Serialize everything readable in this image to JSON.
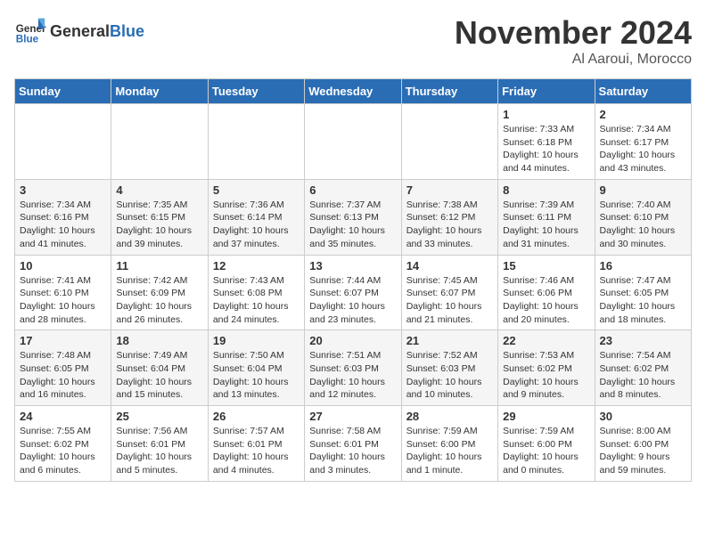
{
  "header": {
    "logo_general": "General",
    "logo_blue": "Blue",
    "month_title": "November 2024",
    "location": "Al Aaroui, Morocco"
  },
  "weekdays": [
    "Sunday",
    "Monday",
    "Tuesday",
    "Wednesday",
    "Thursday",
    "Friday",
    "Saturday"
  ],
  "weeks": [
    [
      {
        "day": "",
        "content": ""
      },
      {
        "day": "",
        "content": ""
      },
      {
        "day": "",
        "content": ""
      },
      {
        "day": "",
        "content": ""
      },
      {
        "day": "",
        "content": ""
      },
      {
        "day": "1",
        "content": "Sunrise: 7:33 AM\nSunset: 6:18 PM\nDaylight: 10 hours and 44 minutes."
      },
      {
        "day": "2",
        "content": "Sunrise: 7:34 AM\nSunset: 6:17 PM\nDaylight: 10 hours and 43 minutes."
      }
    ],
    [
      {
        "day": "3",
        "content": "Sunrise: 7:34 AM\nSunset: 6:16 PM\nDaylight: 10 hours and 41 minutes."
      },
      {
        "day": "4",
        "content": "Sunrise: 7:35 AM\nSunset: 6:15 PM\nDaylight: 10 hours and 39 minutes."
      },
      {
        "day": "5",
        "content": "Sunrise: 7:36 AM\nSunset: 6:14 PM\nDaylight: 10 hours and 37 minutes."
      },
      {
        "day": "6",
        "content": "Sunrise: 7:37 AM\nSunset: 6:13 PM\nDaylight: 10 hours and 35 minutes."
      },
      {
        "day": "7",
        "content": "Sunrise: 7:38 AM\nSunset: 6:12 PM\nDaylight: 10 hours and 33 minutes."
      },
      {
        "day": "8",
        "content": "Sunrise: 7:39 AM\nSunset: 6:11 PM\nDaylight: 10 hours and 31 minutes."
      },
      {
        "day": "9",
        "content": "Sunrise: 7:40 AM\nSunset: 6:10 PM\nDaylight: 10 hours and 30 minutes."
      }
    ],
    [
      {
        "day": "10",
        "content": "Sunrise: 7:41 AM\nSunset: 6:10 PM\nDaylight: 10 hours and 28 minutes."
      },
      {
        "day": "11",
        "content": "Sunrise: 7:42 AM\nSunset: 6:09 PM\nDaylight: 10 hours and 26 minutes."
      },
      {
        "day": "12",
        "content": "Sunrise: 7:43 AM\nSunset: 6:08 PM\nDaylight: 10 hours and 24 minutes."
      },
      {
        "day": "13",
        "content": "Sunrise: 7:44 AM\nSunset: 6:07 PM\nDaylight: 10 hours and 23 minutes."
      },
      {
        "day": "14",
        "content": "Sunrise: 7:45 AM\nSunset: 6:07 PM\nDaylight: 10 hours and 21 minutes."
      },
      {
        "day": "15",
        "content": "Sunrise: 7:46 AM\nSunset: 6:06 PM\nDaylight: 10 hours and 20 minutes."
      },
      {
        "day": "16",
        "content": "Sunrise: 7:47 AM\nSunset: 6:05 PM\nDaylight: 10 hours and 18 minutes."
      }
    ],
    [
      {
        "day": "17",
        "content": "Sunrise: 7:48 AM\nSunset: 6:05 PM\nDaylight: 10 hours and 16 minutes."
      },
      {
        "day": "18",
        "content": "Sunrise: 7:49 AM\nSunset: 6:04 PM\nDaylight: 10 hours and 15 minutes."
      },
      {
        "day": "19",
        "content": "Sunrise: 7:50 AM\nSunset: 6:04 PM\nDaylight: 10 hours and 13 minutes."
      },
      {
        "day": "20",
        "content": "Sunrise: 7:51 AM\nSunset: 6:03 PM\nDaylight: 10 hours and 12 minutes."
      },
      {
        "day": "21",
        "content": "Sunrise: 7:52 AM\nSunset: 6:03 PM\nDaylight: 10 hours and 10 minutes."
      },
      {
        "day": "22",
        "content": "Sunrise: 7:53 AM\nSunset: 6:02 PM\nDaylight: 10 hours and 9 minutes."
      },
      {
        "day": "23",
        "content": "Sunrise: 7:54 AM\nSunset: 6:02 PM\nDaylight: 10 hours and 8 minutes."
      }
    ],
    [
      {
        "day": "24",
        "content": "Sunrise: 7:55 AM\nSunset: 6:02 PM\nDaylight: 10 hours and 6 minutes."
      },
      {
        "day": "25",
        "content": "Sunrise: 7:56 AM\nSunset: 6:01 PM\nDaylight: 10 hours and 5 minutes."
      },
      {
        "day": "26",
        "content": "Sunrise: 7:57 AM\nSunset: 6:01 PM\nDaylight: 10 hours and 4 minutes."
      },
      {
        "day": "27",
        "content": "Sunrise: 7:58 AM\nSunset: 6:01 PM\nDaylight: 10 hours and 3 minutes."
      },
      {
        "day": "28",
        "content": "Sunrise: 7:59 AM\nSunset: 6:00 PM\nDaylight: 10 hours and 1 minute."
      },
      {
        "day": "29",
        "content": "Sunrise: 7:59 AM\nSunset: 6:00 PM\nDaylight: 10 hours and 0 minutes."
      },
      {
        "day": "30",
        "content": "Sunrise: 8:00 AM\nSunset: 6:00 PM\nDaylight: 9 hours and 59 minutes."
      }
    ]
  ]
}
